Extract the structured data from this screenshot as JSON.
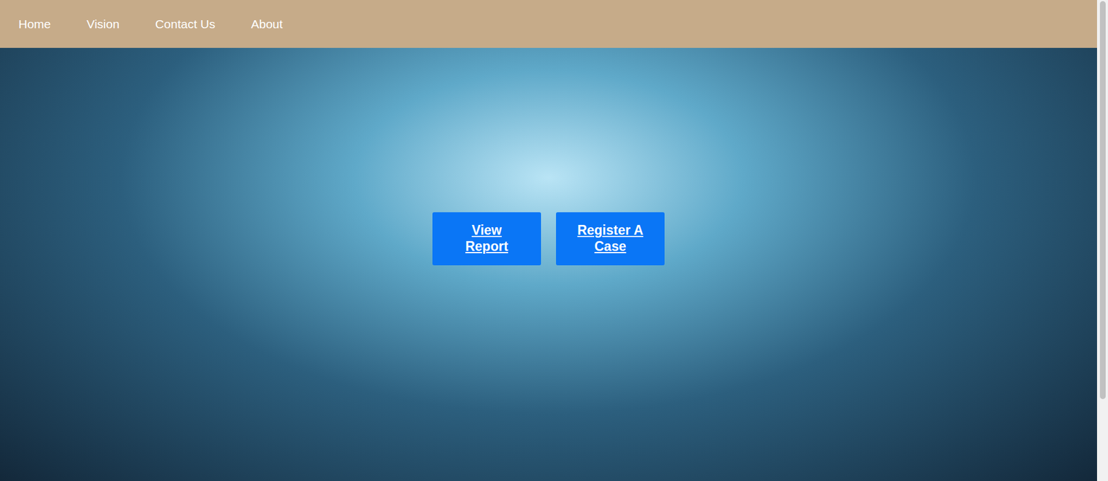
{
  "nav": {
    "items": [
      {
        "label": "Home"
      },
      {
        "label": "Vision"
      },
      {
        "label": "Contact Us"
      },
      {
        "label": "About"
      }
    ]
  },
  "hero": {
    "buttons": [
      {
        "label": "View Report"
      },
      {
        "label": "Register A Case"
      }
    ]
  }
}
